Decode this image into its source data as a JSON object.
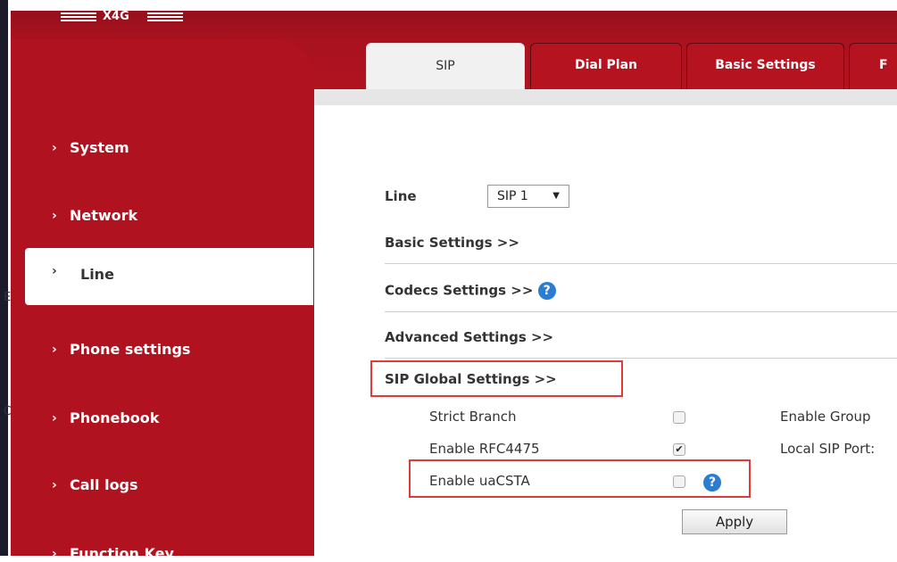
{
  "header": {
    "model": "X4G"
  },
  "left_strip": {
    "letters": [
      "E",
      "C"
    ]
  },
  "sidebar": {
    "items": [
      {
        "label": "System"
      },
      {
        "label": "Network"
      },
      {
        "label": "Line",
        "active": true
      },
      {
        "label": "Phone settings"
      },
      {
        "label": "Phonebook"
      },
      {
        "label": "Call logs"
      },
      {
        "label": "Function Key"
      }
    ],
    "chevron": "›"
  },
  "tabs": [
    {
      "label": "SIP",
      "active": true
    },
    {
      "label": "Dial Plan"
    },
    {
      "label": "Basic Settings"
    },
    {
      "label": "F"
    }
  ],
  "form": {
    "line_label": "Line",
    "line_value": "SIP 1",
    "line_arrow": "▼",
    "sections": [
      {
        "label": "Basic Settings >>"
      },
      {
        "label": "Codecs Settings >>",
        "help": true
      },
      {
        "label": "Advanced Settings >>"
      },
      {
        "label": "SIP Global Settings >>"
      }
    ],
    "options": [
      {
        "label": "Strict Branch",
        "checked": false
      },
      {
        "label": "Enable RFC4475",
        "checked": true
      },
      {
        "label": "Enable uaCSTA",
        "checked": false
      }
    ],
    "right_options": [
      {
        "label": "Enable Group"
      },
      {
        "label": "Local SIP Port:"
      }
    ],
    "help_glyph": "?",
    "check_glyph": "✔",
    "apply_label": "Apply"
  },
  "colors": {
    "brand_red": "#b0131f",
    "highlight": "#e13a3a",
    "help_blue": "#2a7dd0"
  }
}
